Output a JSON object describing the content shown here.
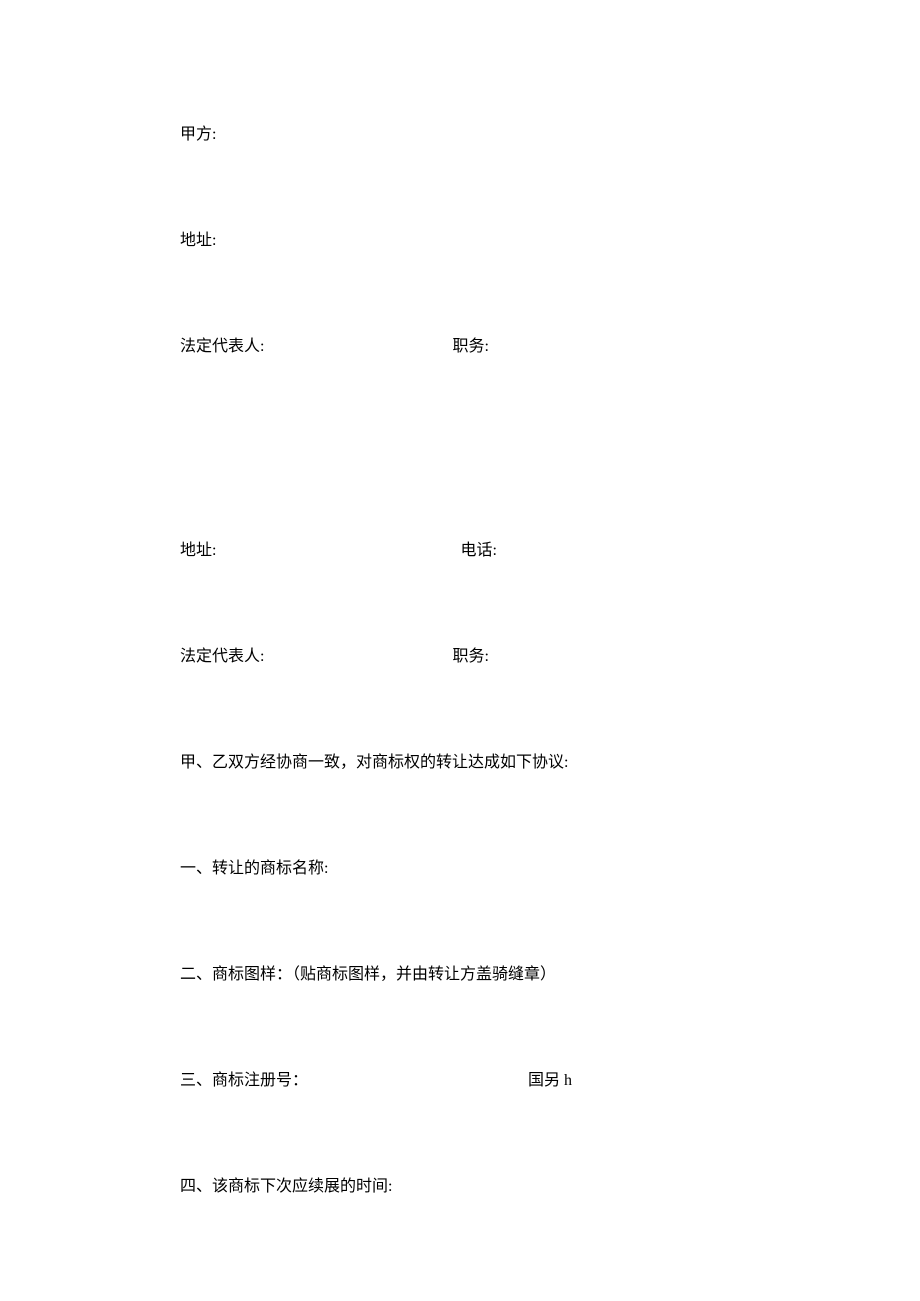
{
  "partyA": {
    "label": "甲方:"
  },
  "address1": {
    "label": "地址:"
  },
  "legalRep1": {
    "label": "法定代表人:",
    "positionLabel": "职务:"
  },
  "address2": {
    "label": "地址:",
    "phoneLabel": "电话:"
  },
  "legalRep2": {
    "label": "法定代表人:",
    "positionLabel": "职务:"
  },
  "intro": "甲、乙双方经协商一致，对商标权的转让达成如下协议:",
  "section1": "一、转让的商标名称:",
  "section2": "二、商标图样：（贴商标图样，并由转让方盖骑缝章）",
  "section3": {
    "label": "三、商标注册号：",
    "rightLabel": "国另 h"
  },
  "section4": "四、该商标下次应续展的时间:"
}
